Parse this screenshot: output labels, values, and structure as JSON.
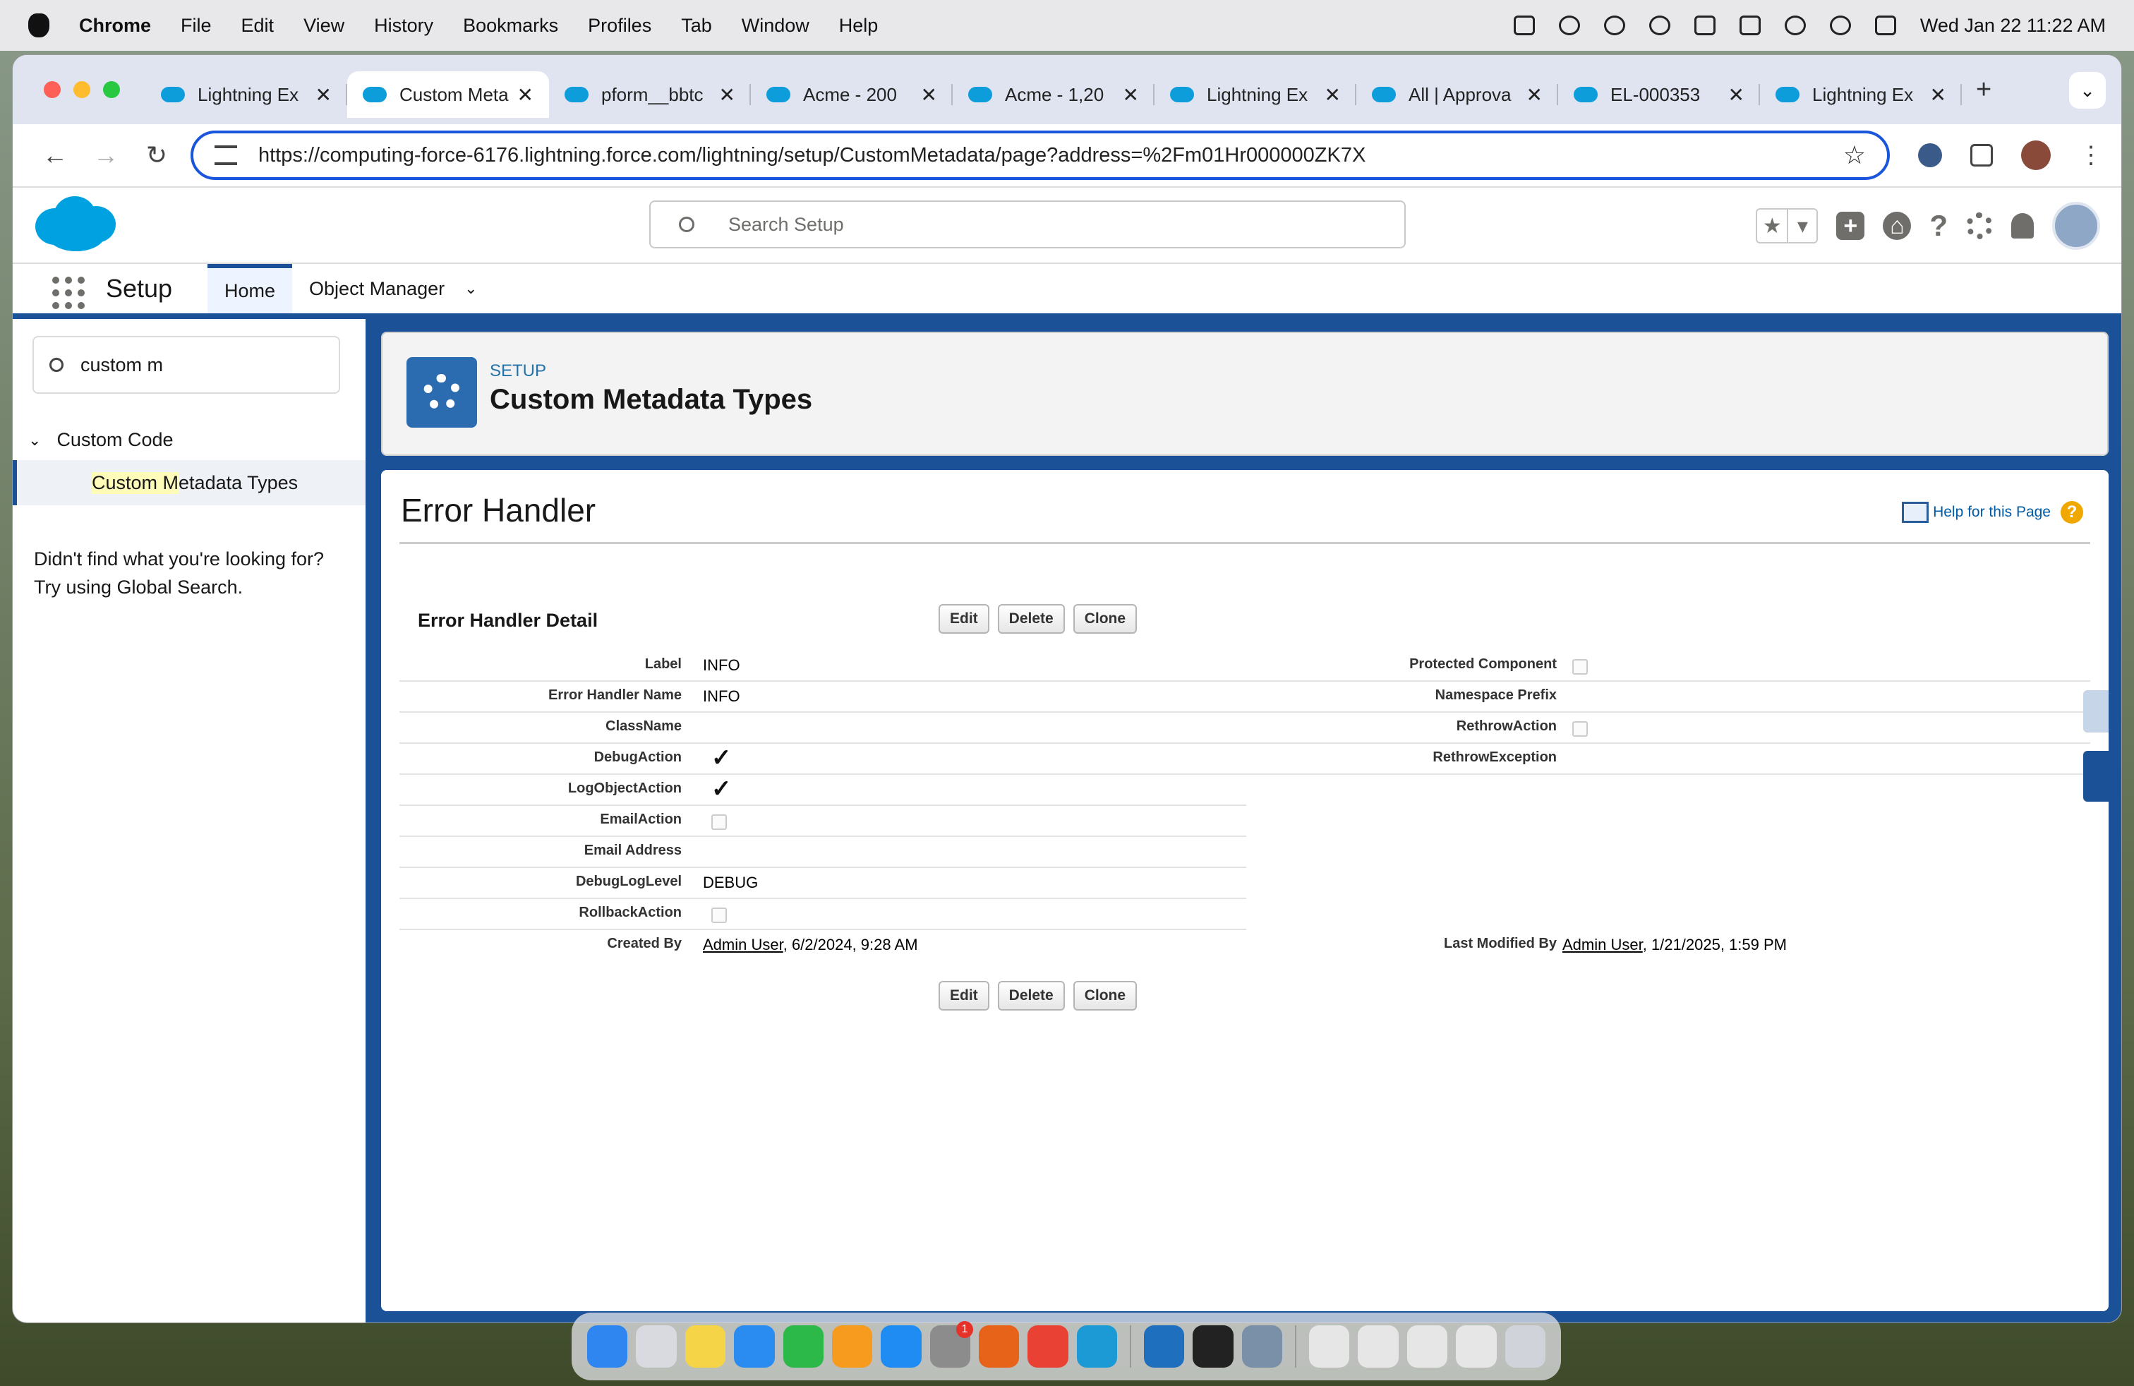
{
  "menubar": {
    "items": [
      "Chrome",
      "File",
      "Edit",
      "View",
      "History",
      "Bookmarks",
      "Profiles",
      "Tab",
      "Window",
      "Help"
    ],
    "datetime": "Wed Jan 22  11:22 AM"
  },
  "browser": {
    "tabs": [
      {
        "title": "Lightning Ex"
      },
      {
        "title": "Custom Meta"
      },
      {
        "title": "pform__bbtc"
      },
      {
        "title": "Acme - 200"
      },
      {
        "title": "Acme - 1,20"
      },
      {
        "title": "Lightning Ex"
      },
      {
        "title": "All | Approva"
      },
      {
        "title": "EL-000353"
      },
      {
        "title": "Lightning Ex"
      }
    ],
    "url": "https://computing-force-6176.lightning.force.com/lightning/setup/CustomMetadata/page?address=%2Fm01Hr000000ZK7X"
  },
  "sf_header": {
    "search_placeholder": "Search Setup"
  },
  "app_nav": {
    "app_name": "Setup",
    "tabs": [
      {
        "label": "Home"
      },
      {
        "label": "Object Manager"
      }
    ]
  },
  "sidebar": {
    "quickfind_value": "custom m",
    "tree_group": "Custom Code",
    "tree_item_hl": "Custom M",
    "tree_item_rest": "etadata Types",
    "notfound_line1": "Didn't find what you're looking for?",
    "notfound_line2": "Try using Global Search."
  },
  "page_header": {
    "eyebrow": "SETUP",
    "title": "Custom Metadata Types"
  },
  "record": {
    "page_title": "Error Handler",
    "help_link": "Help for this Page",
    "section_title": "Error Handler Detail",
    "buttons": {
      "edit": "Edit",
      "delete": "Delete",
      "clone": "Clone"
    },
    "left_fields": [
      {
        "label": "Label",
        "value": "INFO"
      },
      {
        "label": "Error Handler Name",
        "value": "INFO"
      },
      {
        "label": "ClassName",
        "value": ""
      },
      {
        "label": "DebugAction",
        "checked": true
      },
      {
        "label": "LogObjectAction",
        "checked": true
      },
      {
        "label": "EmailAction",
        "checked": false
      },
      {
        "label": "Email Address",
        "value": ""
      },
      {
        "label": "DebugLogLevel",
        "value": "DEBUG"
      },
      {
        "label": "RollbackAction",
        "checked": false
      }
    ],
    "right_fields": [
      {
        "label": "Protected Component",
        "checked": false
      },
      {
        "label": "Namespace Prefix",
        "value": ""
      },
      {
        "label": "RethrowAction",
        "checked": false
      },
      {
        "label": "RethrowException",
        "value": ""
      }
    ],
    "created_by_label": "Created By",
    "created_by_user": "Admin User",
    "created_by_date": ", 6/2/2024, 9:28 AM",
    "modified_by_label": "Last Modified By",
    "modified_by_user": "Admin User",
    "modified_by_date": ", 1/21/2025, 1:59 PM"
  },
  "dock": {
    "notification_badge": "1"
  }
}
